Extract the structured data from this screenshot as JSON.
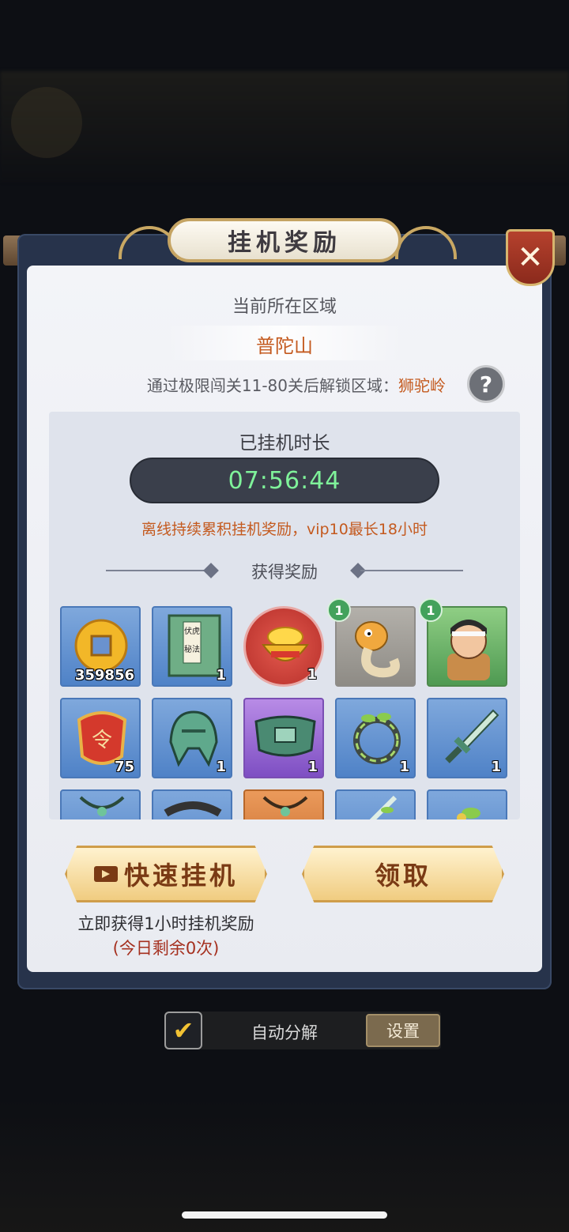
{
  "dialog": {
    "title": "挂机奖励",
    "close_symbol": "✕",
    "region_label": "当前所在区域",
    "region_name": "普陀山",
    "unlock_text": "通过极限闯关11-80关后解锁区域：",
    "unlock_region": "狮驼岭",
    "help_symbol": "?",
    "duration_label": "已挂机时长",
    "duration_value": "07:56:44",
    "offline_note": "离线持续累积挂机奖励，vip10最长18小时",
    "rewards_label": "获得奖励",
    "rewards": [
      {
        "name": "copper-coin",
        "qty": "359856",
        "rarity": "blue"
      },
      {
        "name": "skill-book",
        "book_text": "伏虎秘法",
        "qty": "1",
        "rarity": "blue"
      },
      {
        "name": "golden-treasure-bowl",
        "qty": "1",
        "rarity": "red"
      },
      {
        "name": "seahorse-pet",
        "badge": "1",
        "rarity": "gray"
      },
      {
        "name": "hero-warrior",
        "badge": "1",
        "rarity": "green"
      },
      {
        "name": "order-token",
        "token_text": "令",
        "qty": "75",
        "rarity": "blue"
      },
      {
        "name": "jade-helmet",
        "qty": "1",
        "rarity": "blue"
      },
      {
        "name": "jade-belt",
        "qty": "1",
        "rarity": "purple"
      },
      {
        "name": "vine-ring",
        "qty": "1",
        "rarity": "blue"
      },
      {
        "name": "jade-sword",
        "qty": "1",
        "rarity": "blue"
      },
      {
        "name": "jade-necklace",
        "rarity": "blue"
      },
      {
        "name": "dark-armor",
        "rarity": "blue"
      },
      {
        "name": "amber-necklace",
        "rarity": "orange"
      },
      {
        "name": "vine-sword",
        "rarity": "blue"
      },
      {
        "name": "vine-ornament",
        "rarity": "blue"
      }
    ],
    "quick_button": "快速挂机",
    "quick_sub": "立即获得1小时挂机奖励",
    "quick_remaining": "(今日剩余0次)",
    "claim_button": "领取"
  },
  "footer": {
    "checkbox_mark": "✔",
    "auto_label": "自动分解",
    "settings_button": "设置"
  }
}
